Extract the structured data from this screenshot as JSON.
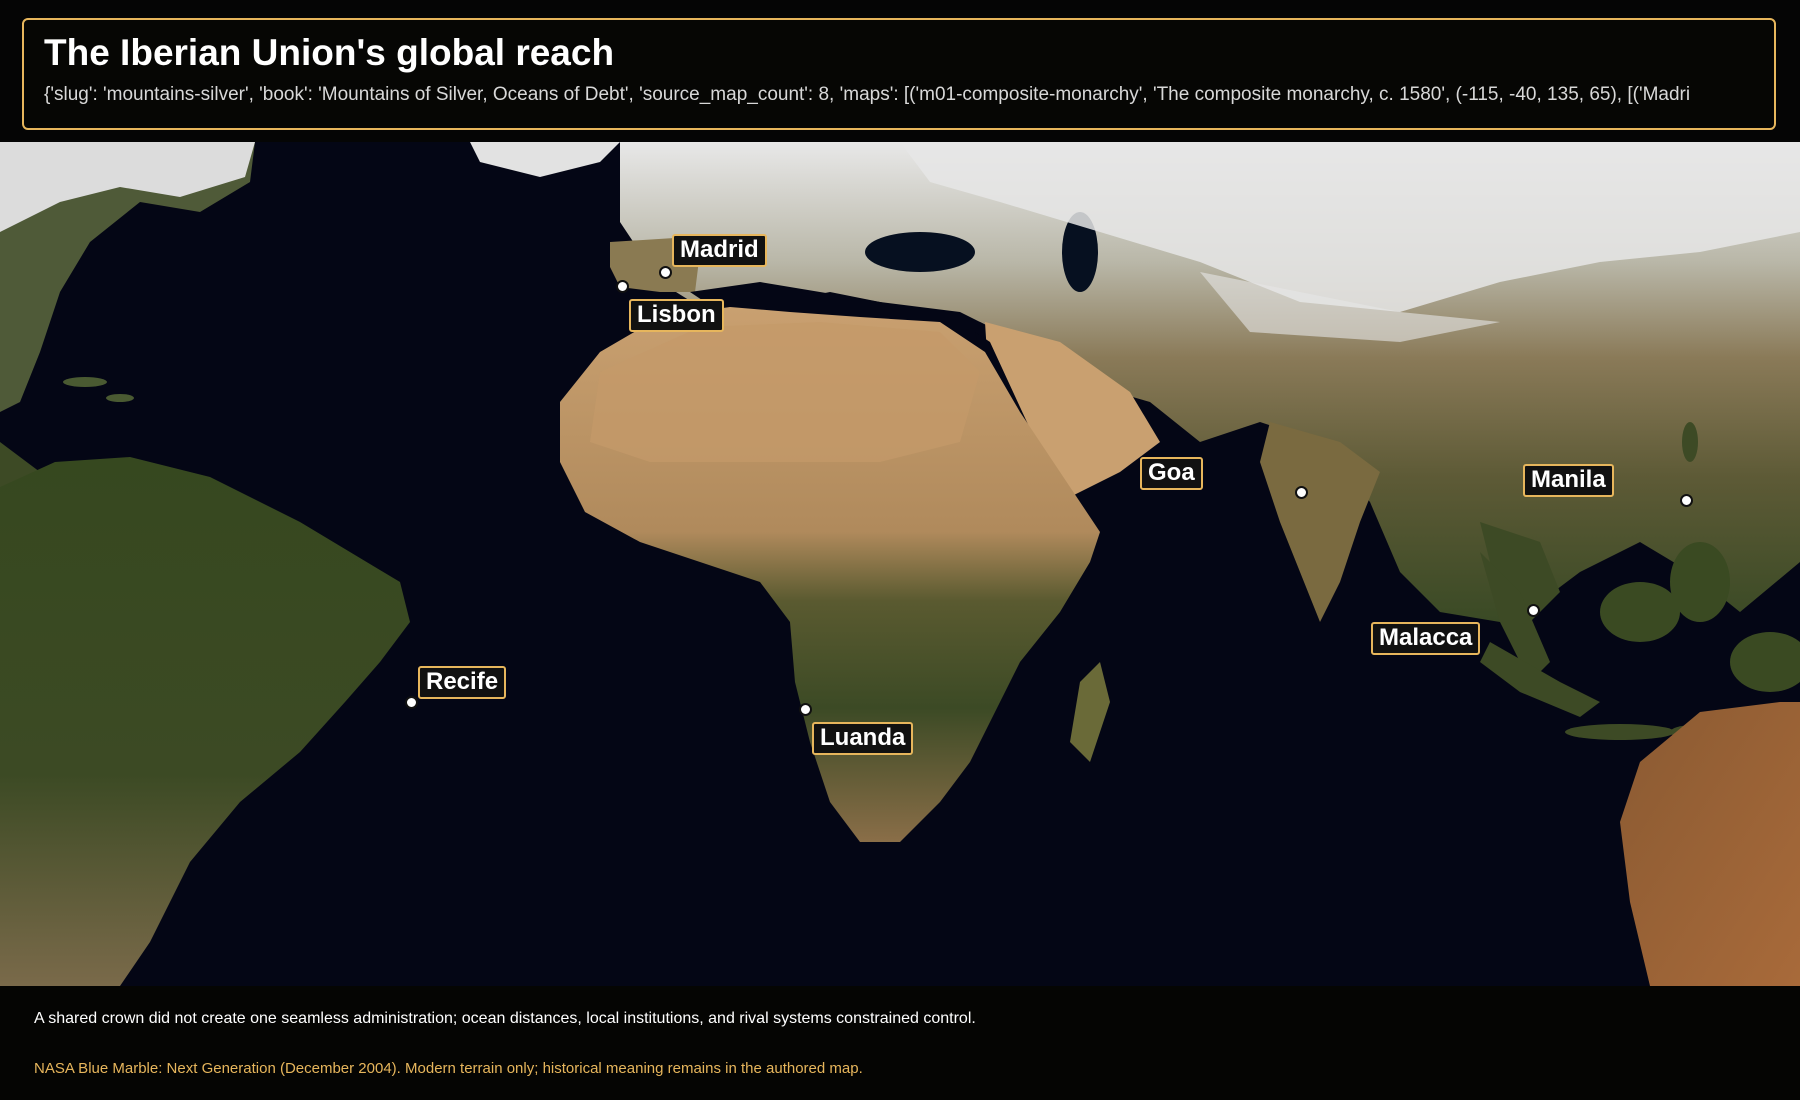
{
  "header": {
    "title": "The Iberian Union's global reach",
    "subtitle": "{'slug': 'mountains-silver', 'book': 'Mountains of Silver, Oceans of Debt', 'source_map_count': 8, 'maps': [('m01-composite-monarchy', 'The composite monarchy, c. 1580', (-115, -40, 135, 65), [('Madri"
  },
  "map": {
    "cities": [
      {
        "id": "madrid",
        "label": "Madrid"
      },
      {
        "id": "lisbon",
        "label": "Lisbon"
      },
      {
        "id": "goa",
        "label": "Goa"
      },
      {
        "id": "manila",
        "label": "Manila"
      },
      {
        "id": "malacca",
        "label": "Malacca"
      },
      {
        "id": "recife",
        "label": "Recife"
      },
      {
        "id": "luanda",
        "label": "Luanda"
      }
    ],
    "colors": {
      "ocean": "#040615",
      "label_border": "#e7b65c",
      "desert": "#c49a6a",
      "forest": "#3a4a26",
      "snow": "#e6e6e6"
    }
  },
  "footer": {
    "caption": "A shared crown did not create one seamless administration; ocean distances, local institutions, and rival systems constrained control.",
    "credit": "NASA Blue Marble: Next Generation (December 2004). Modern terrain only; historical meaning remains in the authored map."
  }
}
